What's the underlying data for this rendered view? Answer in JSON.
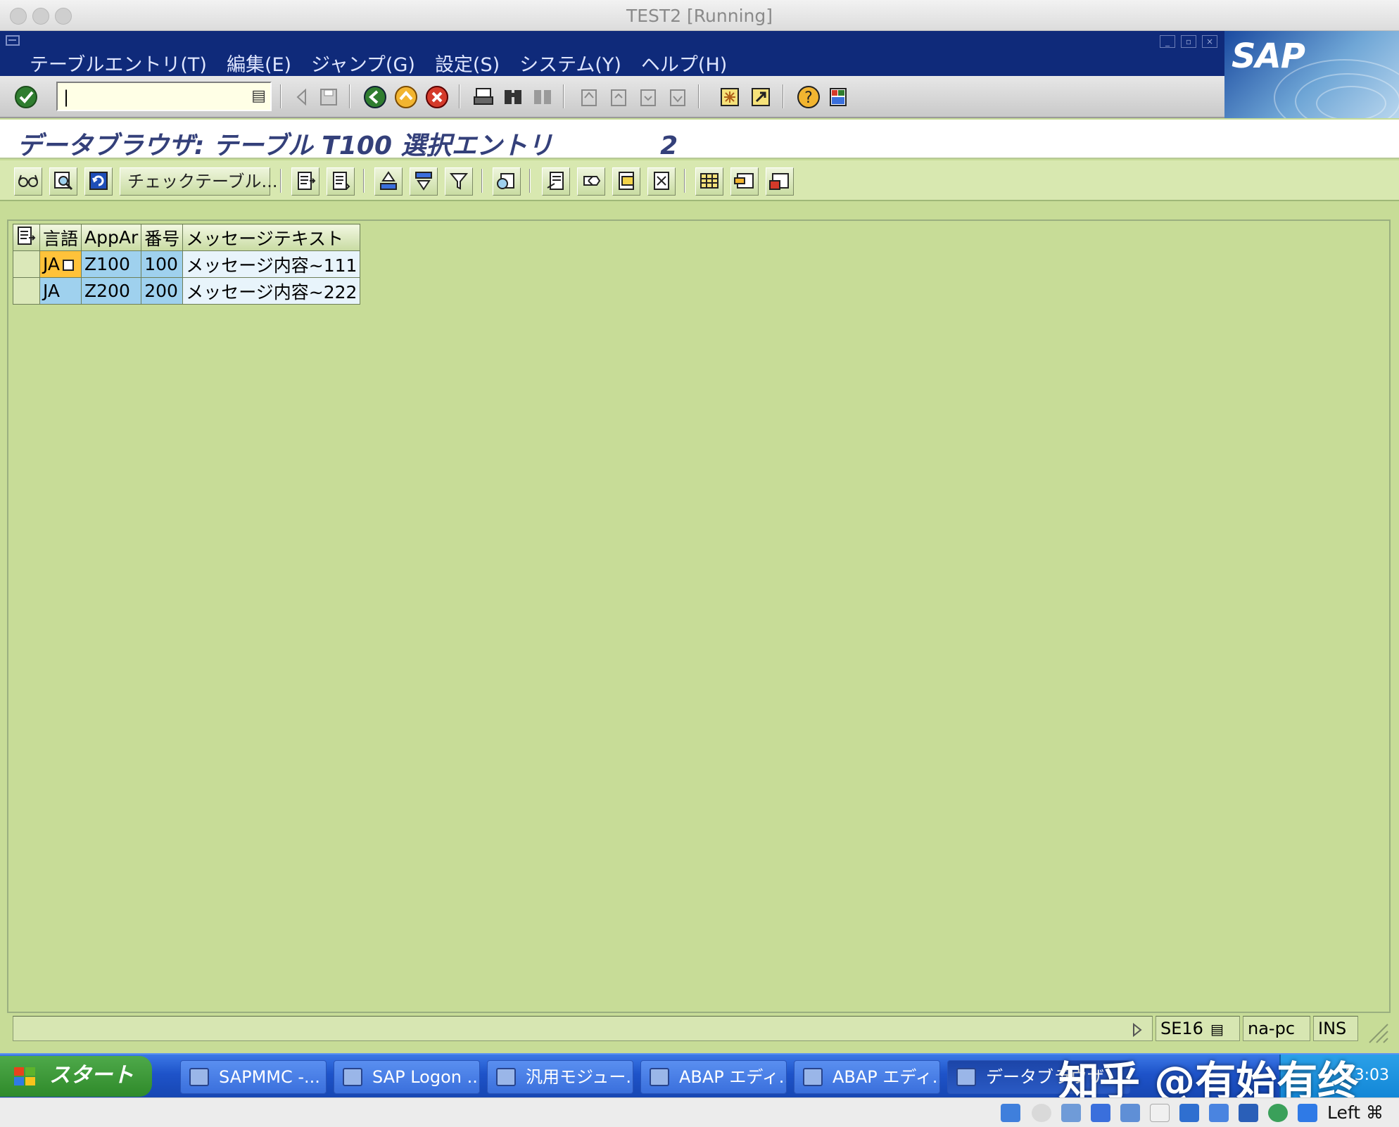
{
  "window": {
    "title": "TEST2 [Running]"
  },
  "menu": {
    "items": [
      "テーブルエントリ(T)",
      "編集(E)",
      "ジャンプ(G)",
      "設定(S)",
      "システム(Y)",
      "ヘルプ(H)"
    ]
  },
  "brand": {
    "logo": "SAP"
  },
  "command_field": {
    "value": "|"
  },
  "screen": {
    "title": "データブラウザ: テーブル T100 選択エントリ",
    "count": "2"
  },
  "app_toolbar": {
    "check_table_label": "チェックテーブル..."
  },
  "table": {
    "columns": [
      "言語",
      "AppAr",
      "番号",
      "メッセージテキスト"
    ],
    "rows": [
      {
        "lang": "JA",
        "appar": "Z100",
        "number": "100",
        "text": "メッセージ内容~111"
      },
      {
        "lang": "JA",
        "appar": "Z200",
        "number": "200",
        "text": "メッセージ内容~222"
      }
    ]
  },
  "status": {
    "transaction": "SE16",
    "server": "na-pc",
    "mode": "INS"
  },
  "taskbar": {
    "start_label": "スタート",
    "tasks": [
      "SAPMMC -...",
      "SAP Logon ...",
      "汎用モジュー...",
      "ABAP エディ...",
      "ABAP エディ...",
      "データブラウザ..."
    ],
    "clock": "13:03"
  },
  "watermark": "知乎 @有始有终",
  "host": {
    "key_label": "Left ⌘"
  },
  "colors": {
    "menubar": "#0f2a7a",
    "workarea": "#c7dc97",
    "focus_cell": "#ffc23a",
    "key_cell": "#9fd1ee",
    "taskbar": "#1e53c9",
    "start": "#3a9a34"
  }
}
